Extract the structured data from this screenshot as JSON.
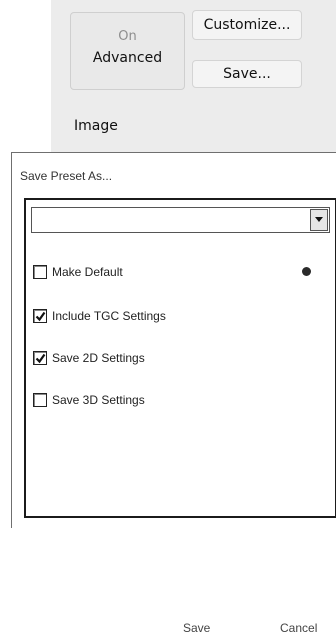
{
  "background": {
    "advanced_toggle": {
      "state": "On",
      "mode": "Advanced"
    },
    "customize_label": "Customize...",
    "save_label": "Save...",
    "image_heading": "Image"
  },
  "dialog": {
    "title": "Save Preset As...",
    "preset_name": {
      "value": "",
      "placeholder": ""
    },
    "options": {
      "make_default": {
        "label": "Make Default",
        "checked": false
      },
      "include_tgc": {
        "label": "Include TGC Settings",
        "checked": true
      },
      "save_2d": {
        "label": "Save 2D Settings",
        "checked": true
      },
      "save_3d": {
        "label": "Save 3D Settings",
        "checked": false
      }
    },
    "save_label": "Save",
    "cancel_label": "Cancel"
  }
}
